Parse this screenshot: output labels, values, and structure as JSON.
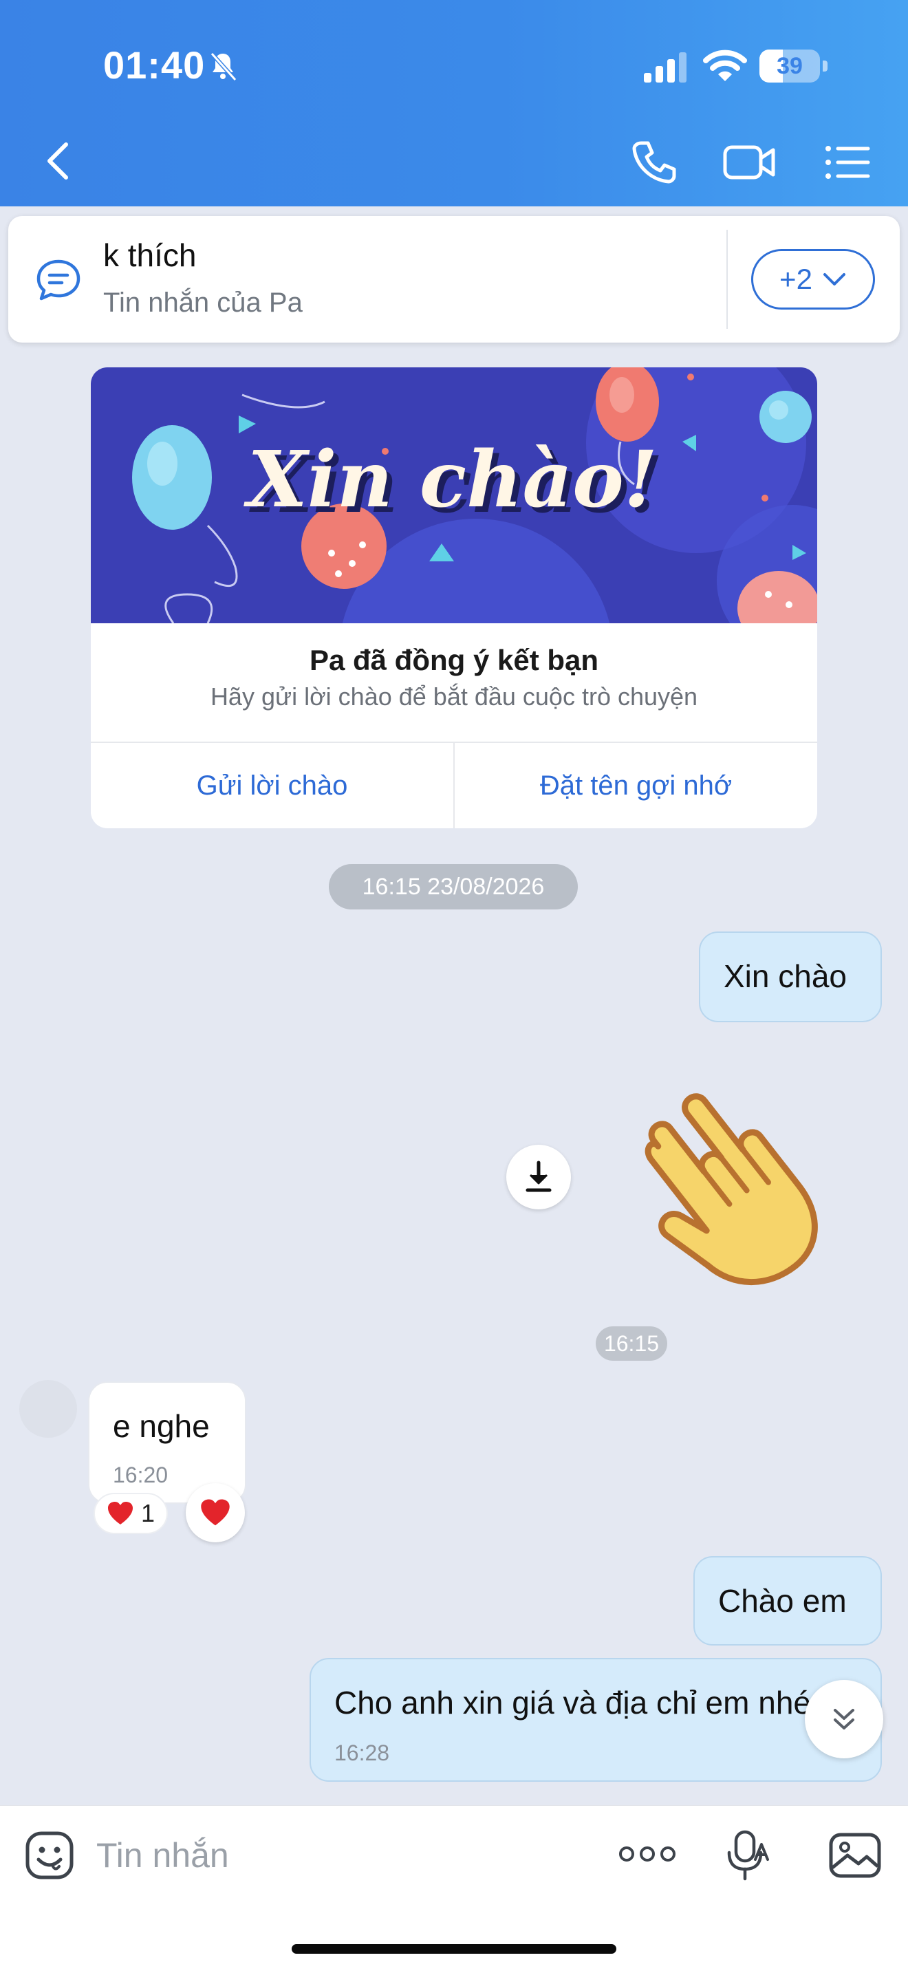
{
  "status_bar": {
    "time": "01:40",
    "battery_level": "39",
    "battery_fraction": 0.39
  },
  "header": {
    "back_icon": "chevron-left-icon",
    "call_icon": "phone-icon",
    "video_icon": "video-camera-icon",
    "menu_icon": "list-icon"
  },
  "pinned": {
    "title": "k thích",
    "subtitle": "Tin nhắn của Pa",
    "more_label": "+2"
  },
  "friend_card": {
    "banner_text": "Xin chào!",
    "title": "Pa đã đồng ý kết bạn",
    "subtitle": "Hãy gửi lời chào để bắt đầu cuộc trò chuyện",
    "send_greeting_label": "Gửi lời chào",
    "nickname_label": "Đặt tên gợi nhớ"
  },
  "messages": {
    "date_separator": "16:15 23/08/2026",
    "msg1": {
      "text": "Xin chào"
    },
    "sticker": {
      "icon": "waving-hand-icon",
      "time": "16:15"
    },
    "msg2": {
      "text": "e nghe",
      "time": "16:20",
      "reaction_count": "1"
    },
    "msg3": {
      "text": "Chào em"
    },
    "msg4": {
      "text": "Cho anh xin giá và địa chỉ em nhé",
      "time": "16:28"
    }
  },
  "input_bar": {
    "placeholder": "Tin nhắn"
  },
  "colors": {
    "header_blue": "#3a83e6",
    "accent_blue": "#2f6fd6",
    "outgoing_bubble": "#d5ebfb",
    "chat_background": "#e4e8f2"
  }
}
